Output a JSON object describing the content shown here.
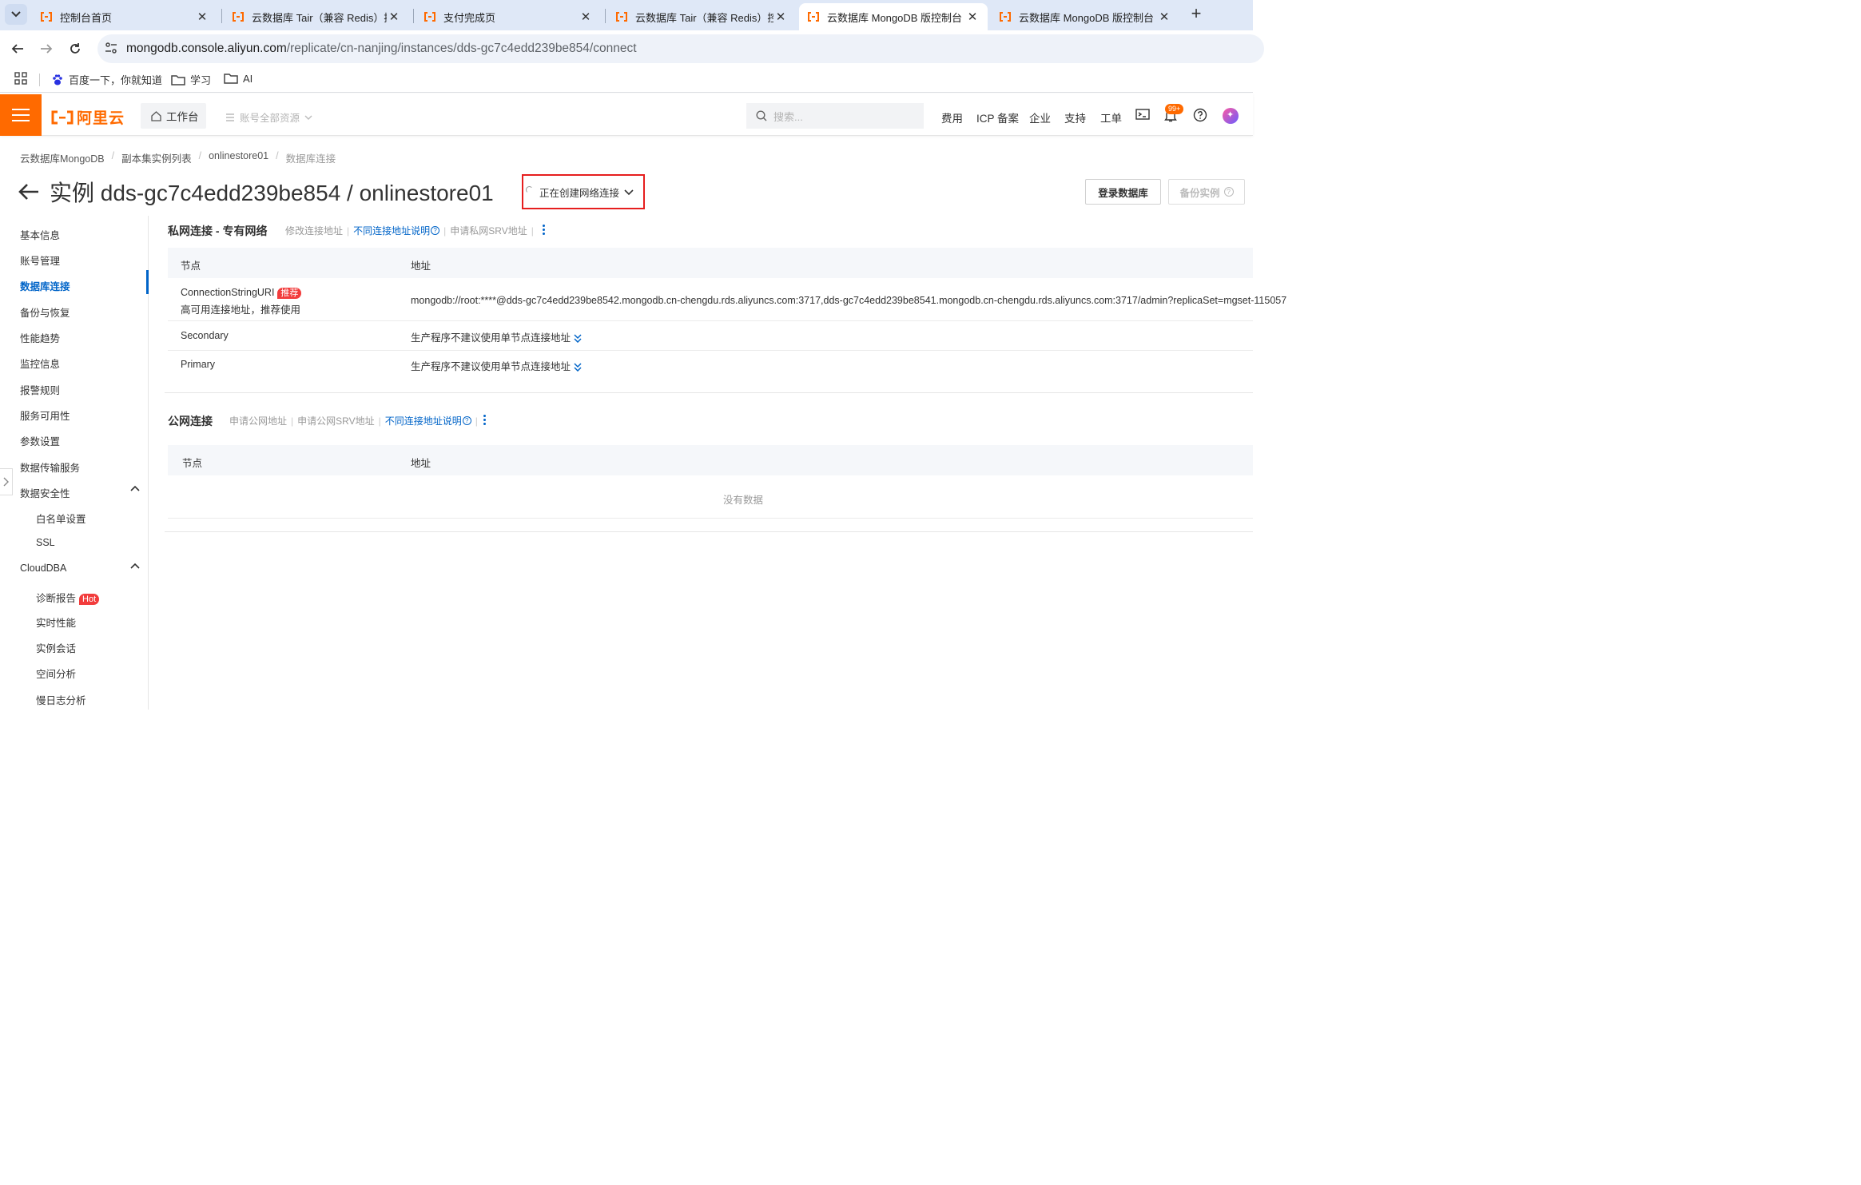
{
  "browser": {
    "tabs": [
      {
        "title": "控制台首页",
        "active": false
      },
      {
        "title": "云数据库 Tair（兼容 Redis）控",
        "active": false
      },
      {
        "title": "支付完成页",
        "active": false
      },
      {
        "title": "云数据库 Tair（兼容 Redis）控",
        "active": false
      },
      {
        "title": "云数据库 MongoDB 版控制台",
        "active": true
      },
      {
        "title": "云数据库 MongoDB 版控制台",
        "active": false
      }
    ],
    "url_host": "mongodb.console.aliyun.com",
    "url_path": "/replicate/cn-nanjing/instances/dds-gc7c4edd239be854/connect",
    "bookmarks": [
      "百度一下，你就知道",
      "学习",
      "AI"
    ]
  },
  "header": {
    "logo_text": "阿里云",
    "workbench": "工作台",
    "resources": "账号全部资源",
    "search_placeholder": "搜索...",
    "nav": [
      "费用",
      "ICP 备案",
      "企业",
      "支持",
      "工单"
    ],
    "notification_count": "99+"
  },
  "breadcrumb": [
    "云数据库MongoDB",
    "副本集实例列表",
    "onlinestore01",
    "数据库连接"
  ],
  "page": {
    "title": "实例 dds-gc7c4edd239be854 / onlinestore01",
    "status": "正在创建网络连接",
    "login_button": "登录数据库",
    "backup_button": "备份实例"
  },
  "sidenav": {
    "items": [
      "基本信息",
      "账号管理",
      "数据库连接",
      "备份与恢复",
      "性能趋势",
      "监控信息",
      "报警规则",
      "服务可用性",
      "参数设置",
      "数据传输服务"
    ],
    "active": "数据库连接",
    "security": {
      "label": "数据安全性",
      "children": [
        "白名单设置",
        "SSL"
      ]
    },
    "clouddba": {
      "label": "CloudDBA",
      "children": [
        "诊断报告",
        "实时性能",
        "实例会话",
        "空间分析",
        "慢日志分析"
      ],
      "hot_label": "Hot"
    }
  },
  "private": {
    "title": "私网连接 - 专有网络",
    "links": [
      "修改连接地址",
      "不同连接地址说明",
      "申请私网SRV地址"
    ],
    "headers": [
      "节点",
      "地址"
    ],
    "rows": [
      {
        "node": "ConnectionStringURI",
        "tag": "推荐",
        "node_sub": "高可用连接地址，推荐使用",
        "address": "mongodb://root:****@dds-gc7c4edd239be8542.mongodb.cn-chengdu.rds.aliyuncs.com:3717,dds-gc7c4edd239be8541.mongodb.cn-chengdu.rds.aliyuncs.com:3717/admin?replicaSet=mgset-115057"
      },
      {
        "node": "Secondary",
        "address": "生产程序不建议使用单节点连接地址"
      },
      {
        "node": "Primary",
        "address": "生产程序不建议使用单节点连接地址"
      }
    ]
  },
  "public": {
    "title": "公网连接",
    "links": [
      "申请公网地址",
      "申请公网SRV地址",
      "不同连接地址说明"
    ],
    "headers": [
      "节点",
      "地址"
    ],
    "empty_text": "没有数据"
  }
}
